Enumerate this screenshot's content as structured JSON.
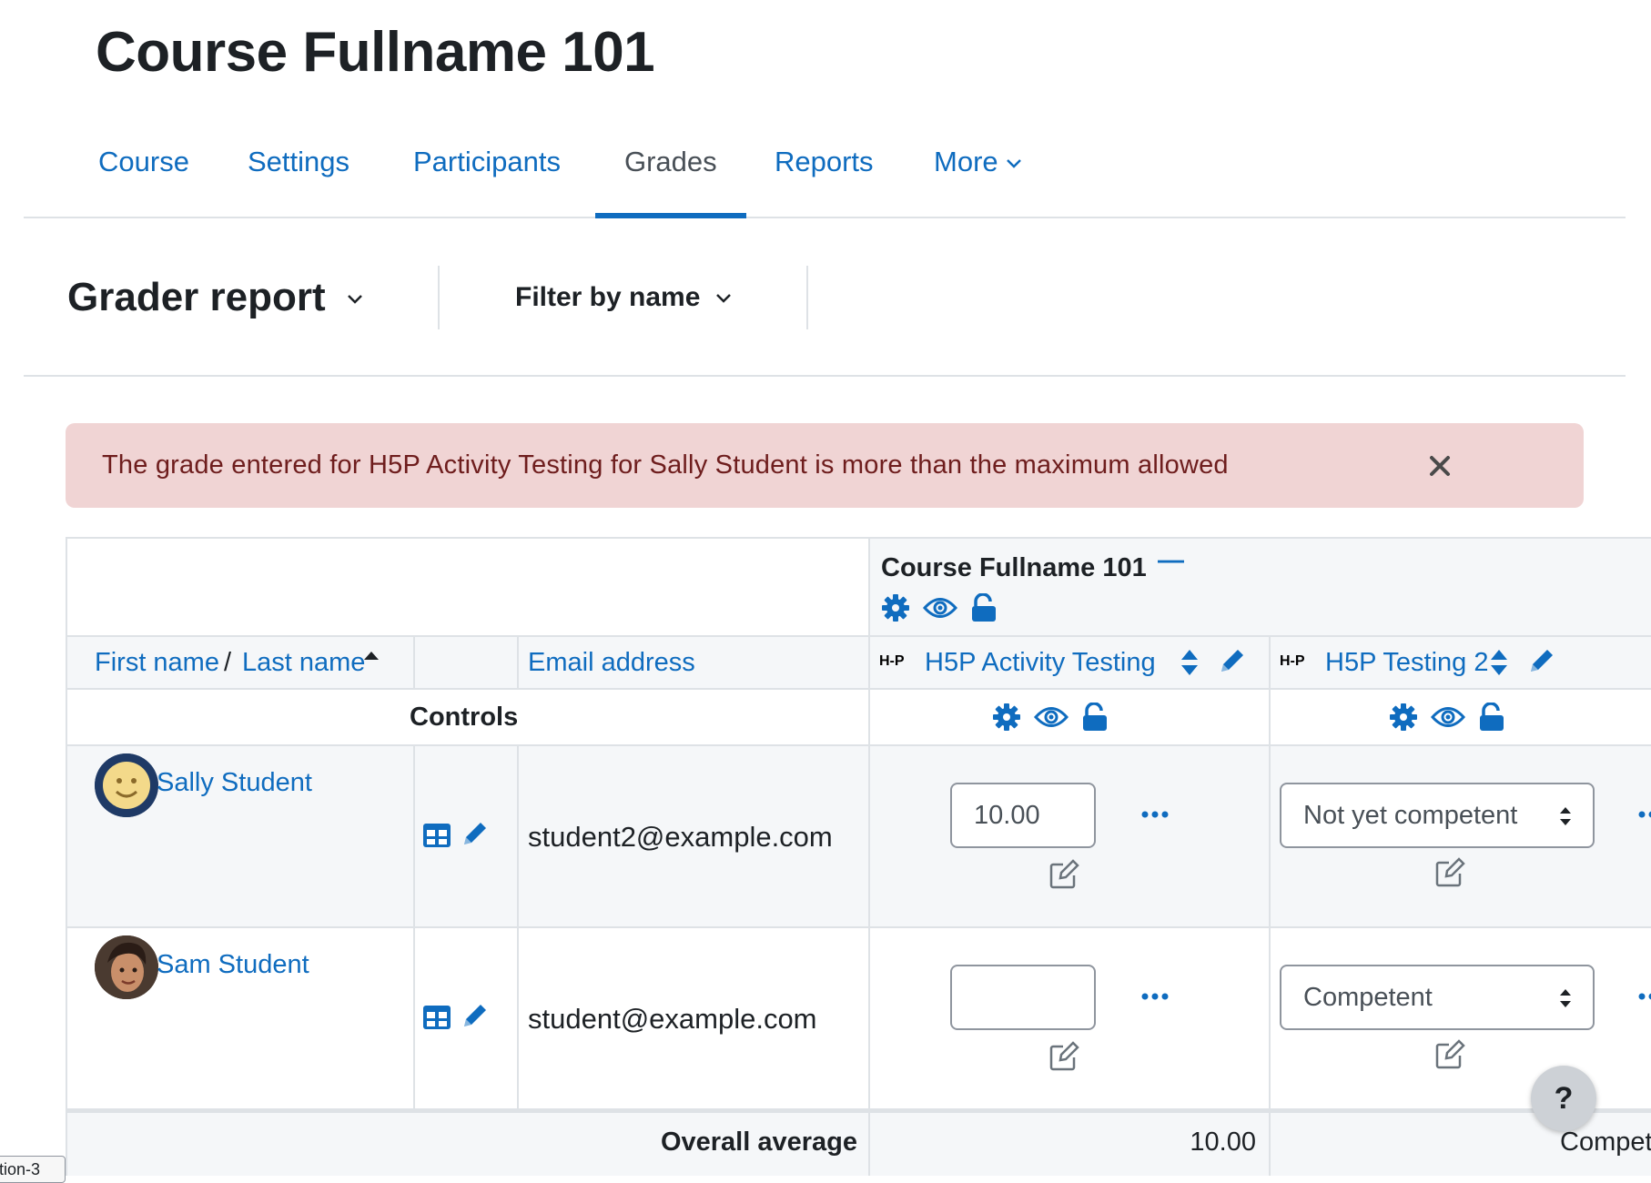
{
  "course": {
    "title": "Course Fullname 101"
  },
  "nav": {
    "tabs": [
      {
        "label": "Course"
      },
      {
        "label": "Settings"
      },
      {
        "label": "Participants"
      },
      {
        "label": "Grades"
      },
      {
        "label": "Reports"
      },
      {
        "label": "More"
      }
    ],
    "active_tab": "Grades"
  },
  "tertiary": {
    "report_select": "Grader report",
    "filter_label": "Filter by name"
  },
  "alert": {
    "message": "The grade entered for H5P Activity Testing for Sally Student is more than the maximum allowed",
    "color": "#f0d4d4"
  },
  "table": {
    "category_title": "Course Fullname 101",
    "category_collapse_symbol": "—",
    "name_header": {
      "first": "First name",
      "separator": "/",
      "last": "Last name"
    },
    "email_header": "Email address",
    "items": [
      {
        "name": "H5P Activity Testing",
        "icon_label": "H-P"
      },
      {
        "name": "H5P Testing 2",
        "icon_label": "H-P"
      }
    ],
    "controls_label": "Controls",
    "rows": [
      {
        "name": "Sally Student",
        "email": "student2@example.com",
        "grade1": "10.00",
        "grade2": "Not yet competent"
      },
      {
        "name": "Sam Student",
        "email": "student@example.com",
        "grade1": "",
        "grade2": "Competent"
      }
    ],
    "overall_average_label": "Overall average",
    "overall_average": {
      "item1": "10.00",
      "item2": "Compete"
    }
  },
  "help": {
    "label": "?"
  },
  "corner_tab": {
    "label": "tion-3"
  },
  "colors": {
    "link": "#0f6cbf",
    "alert_text": "#6e1d1d",
    "border": "#dee2e6"
  }
}
